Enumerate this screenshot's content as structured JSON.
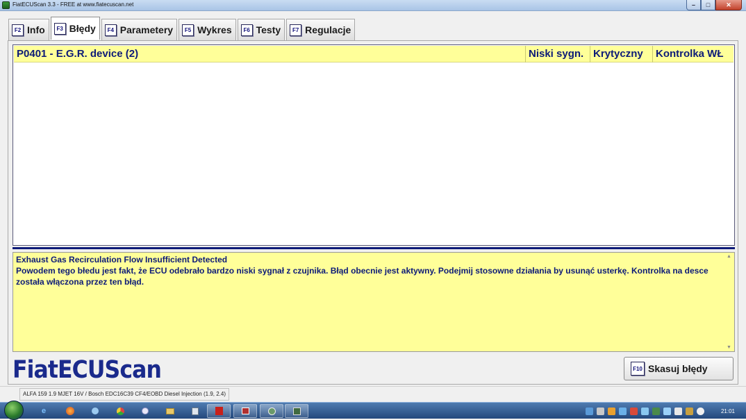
{
  "window": {
    "title": "FiatECUScan 3.3 - FREE at www.fiatecuscan.net",
    "controls": {
      "minimize": "–",
      "maximize": "□",
      "close": "✕"
    }
  },
  "tabs": [
    {
      "key": "F2",
      "label": "Info",
      "active": false
    },
    {
      "key": "F3",
      "label": "Błędy",
      "active": true
    },
    {
      "key": "F4",
      "label": "Parametery",
      "active": false
    },
    {
      "key": "F5",
      "label": "Wykres",
      "active": false
    },
    {
      "key": "F6",
      "label": "Testy",
      "active": false
    },
    {
      "key": "F7",
      "label": "Regulacje",
      "active": false
    }
  ],
  "fault": {
    "code": "P0401 - E.G.R. device (2)",
    "status": "Niski sygn.",
    "severity": "Krytyczny",
    "lamp": "Kontrolka WŁ"
  },
  "description": {
    "title": "Exhaust Gas Recirculation Flow Insufficient Detected",
    "body": "Powodem tego błedu jest fakt, że ECU odebrało bardzo niski sygnał z czujnika. Błąd obecnie jest aktywny. Podejmij stosowne działania by usunąć usterkę. Kontrolka na desce została włączona przez ten błąd."
  },
  "logo": "FiatECUScan",
  "clear_button": {
    "key": "F10",
    "label": "Skasuj błędy"
  },
  "statusbar": {
    "vehicle": "ALFA 159 1.9 MJET 16V / Bosch EDC16C39 CF4/EOBD Diesel Injection (1.9, 2.4)"
  },
  "taskbar": {
    "clock": "21:01",
    "apps": [
      "ie-icon",
      "firefox-icon",
      "network-icon",
      "chrome-icon",
      "paint-icon",
      "folder-icon",
      "calculator-icon",
      "acrobat-icon",
      "media-icon",
      "fiatecuscan-icon",
      "car-icon"
    ]
  },
  "colors": {
    "highlight": "#ffff99",
    "text_blue": "#0c1a78",
    "logo_blue": "#1a2a8c"
  }
}
